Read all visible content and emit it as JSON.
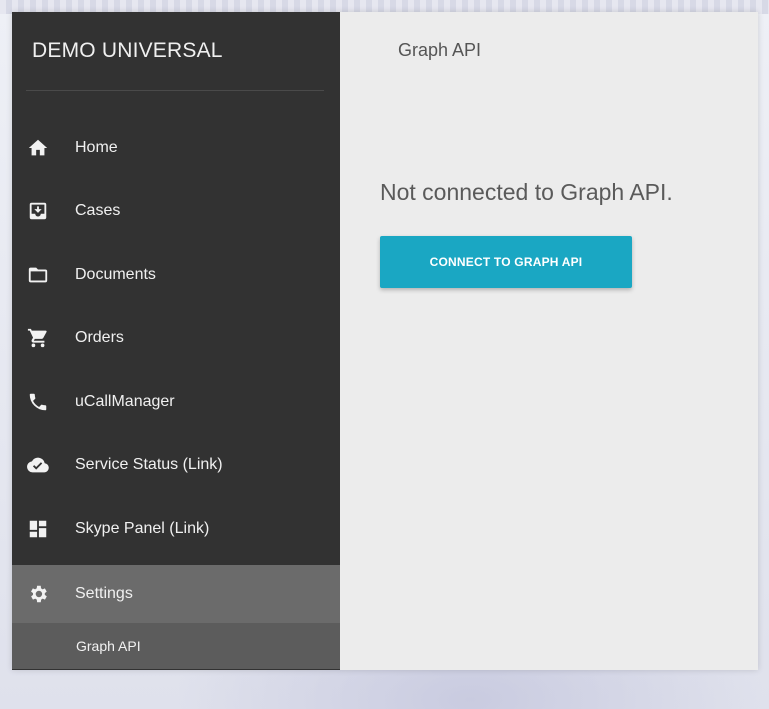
{
  "brand": {
    "title": "DEMO UNIVERSAL"
  },
  "sidebar": {
    "items": [
      {
        "label": "Home",
        "icon": "home-icon"
      },
      {
        "label": "Cases",
        "icon": "inbox-icon"
      },
      {
        "label": "Documents",
        "icon": "folder-icon"
      },
      {
        "label": "Orders",
        "icon": "cart-icon"
      },
      {
        "label": "uCallManager",
        "icon": "phone-icon"
      },
      {
        "label": "Service Status (Link)",
        "icon": "cloud-check-icon"
      },
      {
        "label": "Skype Panel (Link)",
        "icon": "dashboard-icon"
      }
    ],
    "settings": {
      "label": "Settings",
      "icon": "gear-icon"
    },
    "subitem": {
      "label": "Graph API"
    }
  },
  "main": {
    "title": "Graph API",
    "status": "Not connected to Graph API.",
    "connect_label": "CONNECT TO GRAPH API"
  },
  "colors": {
    "sidebar_bg": "#323232",
    "active_bg": "#6b6b6b",
    "accent": "#1aa7c3",
    "content_bg": "#ececec"
  }
}
